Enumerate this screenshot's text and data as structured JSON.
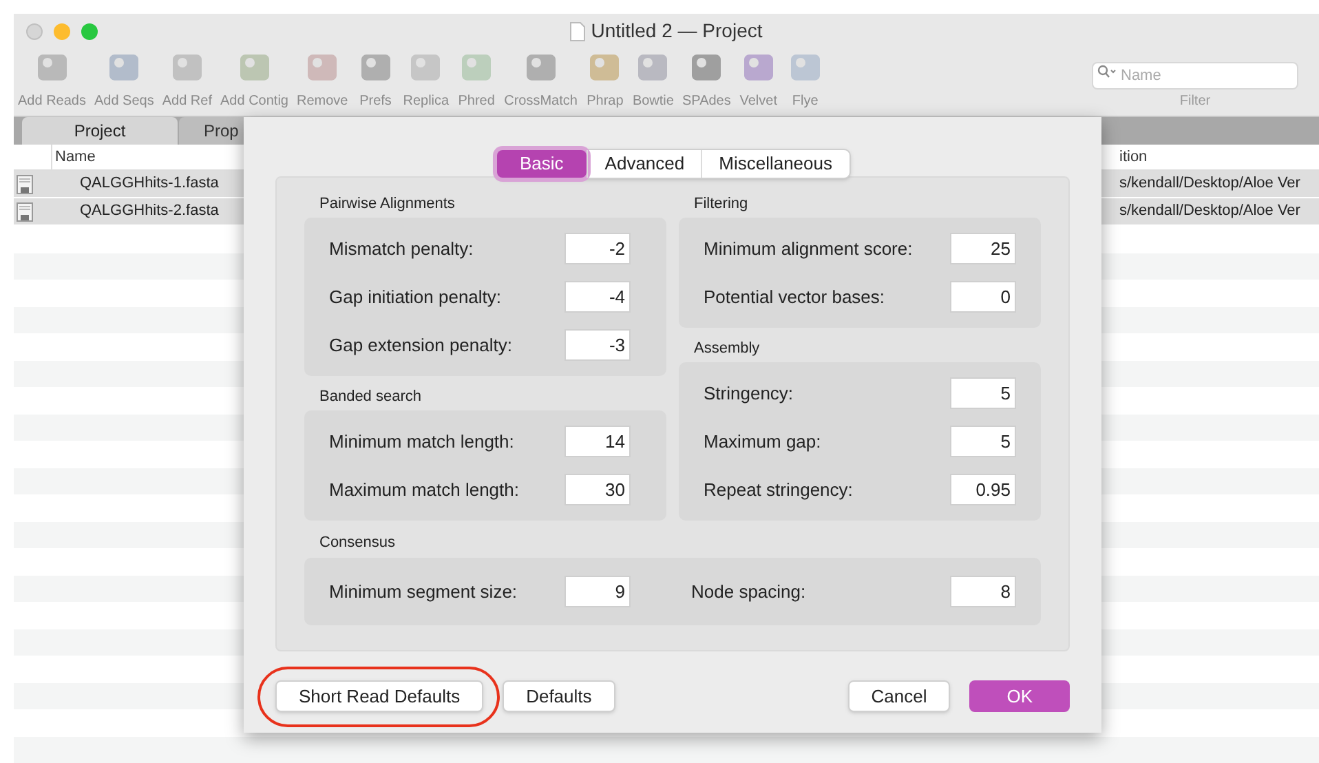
{
  "window": {
    "title": "Untitled 2 — Project"
  },
  "toolbar": [
    {
      "label": "Add Reads"
    },
    {
      "label": "Add Seqs"
    },
    {
      "label": "Add Ref"
    },
    {
      "label": "Add Contig"
    },
    {
      "label": "Remove"
    },
    {
      "label": "Prefs"
    },
    {
      "label": "Replica"
    },
    {
      "label": "Phred"
    },
    {
      "label": "CrossMatch"
    },
    {
      "label": "Phrap"
    },
    {
      "label": "Bowtie"
    },
    {
      "label": "SPAdes"
    },
    {
      "label": "Velvet"
    },
    {
      "label": "Flye"
    }
  ],
  "filter": {
    "placeholder": "Name",
    "label": "Filter"
  },
  "tabs": [
    {
      "label": "Project",
      "selected": true
    },
    {
      "label": "Prop",
      "selected": false
    }
  ],
  "table": {
    "columns": [
      "Name",
      "ition"
    ],
    "rows": [
      {
        "name": "QALGGHhits-1.fasta",
        "location": "s/kendall/Desktop/Aloe Ver"
      },
      {
        "name": "QALGGHhits-2.fasta",
        "location": "s/kendall/Desktop/Aloe Ver"
      }
    ]
  },
  "dialog": {
    "tabs": [
      {
        "label": "Basic",
        "selected": true
      },
      {
        "label": "Advanced",
        "selected": false
      },
      {
        "label": "Miscellaneous",
        "selected": false
      }
    ],
    "columns": [
      [
        {
          "title": "Pairwise Alignments",
          "fields": [
            {
              "label": "Mismatch penalty:",
              "value": "-2"
            },
            {
              "label": "Gap initiation penalty:",
              "value": "-4"
            },
            {
              "label": "Gap extension penalty:",
              "value": "-3"
            }
          ]
        },
        {
          "title": "Banded search",
          "fields": [
            {
              "label": "Minimum match length:",
              "value": "14"
            },
            {
              "label": "Maximum match length:",
              "value": "30"
            }
          ]
        }
      ],
      [
        {
          "title": "Filtering",
          "fields": [
            {
              "label": "Minimum alignment score:",
              "value": "25"
            },
            {
              "label": "Potential vector bases:",
              "value": "0"
            }
          ]
        },
        {
          "title": "Assembly",
          "fields": [
            {
              "label": "Stringency:",
              "value": "5"
            },
            {
              "label": "Maximum gap:",
              "value": "5"
            },
            {
              "label": "Repeat stringency:",
              "value": "0.95"
            }
          ]
        }
      ]
    ],
    "wide_group": {
      "title": "Consensus",
      "fields": [
        {
          "label": "Minimum segment size:",
          "value": "9"
        },
        {
          "label": "Node spacing:",
          "value": "8"
        }
      ]
    },
    "buttons": [
      {
        "label": "Short Read Defaults",
        "kind": "normal",
        "highlighted": true
      },
      {
        "label": "Defaults",
        "kind": "normal",
        "highlighted": false
      },
      {
        "label": "Cancel",
        "kind": "normal",
        "highlighted": false
      },
      {
        "label": "OK",
        "kind": "default",
        "highlighted": false
      }
    ]
  }
}
